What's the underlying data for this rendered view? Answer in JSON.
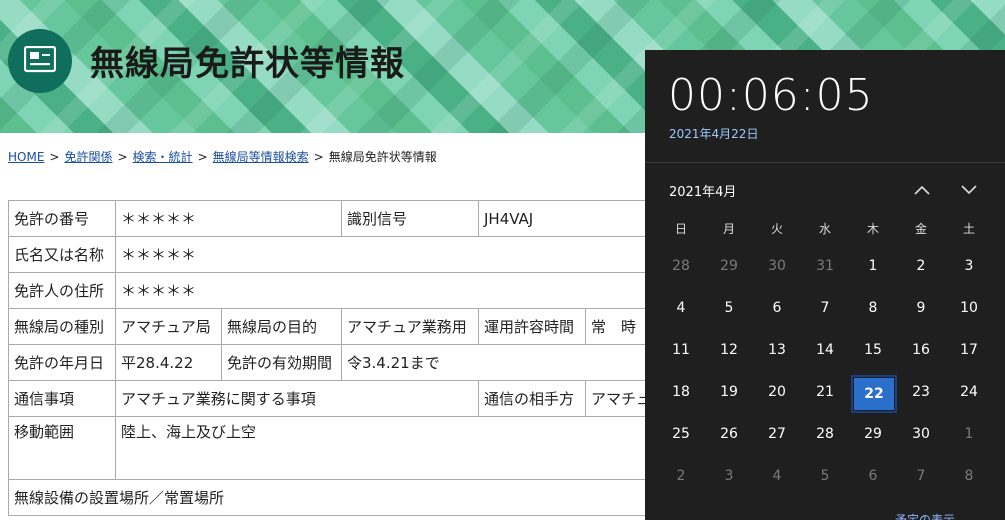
{
  "header": {
    "title": "無線局免許状等情報",
    "icon": "license-card-icon"
  },
  "breadcrumb": {
    "items": [
      "HOME",
      "免許関係",
      "検索・統計",
      "無線局等情報検索"
    ],
    "current": "無線局免許状等情報",
    "separator": ">"
  },
  "table": {
    "r1": {
      "c1": "免許の番号",
      "c2": "＊＊＊＊＊",
      "c3": "識別信号",
      "c4": "JH4VAJ"
    },
    "r2": {
      "c1": "氏名又は名称",
      "c2": "＊＊＊＊＊"
    },
    "r3": {
      "c1": "免許人の住所",
      "c2": "＊＊＊＊＊"
    },
    "r4": {
      "c1": "無線局の種別",
      "c2": "アマチュア局",
      "c3": "無線局の目的",
      "c4": "アマチュア業務用",
      "c5": "運用許容時間",
      "c6": "常　時"
    },
    "r5": {
      "c1": "免許の年月日",
      "c2": "平28.4.22",
      "c3": "免許の有効期間",
      "c4": "令3.4.21まで"
    },
    "r6": {
      "c1": "通信事項",
      "c2": "アマチュア業務に関する事項",
      "c3": "通信の相手方",
      "c4": "アマチュ"
    },
    "r7": {
      "c1": "移動範囲",
      "c2": "陸上、海上及び上空"
    },
    "r8": {
      "c1": "無線設備の設置場所／常置場所"
    }
  },
  "calendar": {
    "time": "00:06:05",
    "date": "2021年4月22日",
    "month_label": "2021年4月",
    "weekdays": [
      "日",
      "月",
      "火",
      "水",
      "木",
      "金",
      "土"
    ],
    "weeks": [
      [
        "28",
        "29",
        "30",
        "31",
        "1",
        "2",
        "3"
      ],
      [
        "4",
        "5",
        "6",
        "7",
        "8",
        "9",
        "10"
      ],
      [
        "11",
        "12",
        "13",
        "14",
        "15",
        "16",
        "17"
      ],
      [
        "18",
        "19",
        "20",
        "21",
        "22",
        "23",
        "24"
      ],
      [
        "25",
        "26",
        "27",
        "28",
        "29",
        "30",
        "1"
      ],
      [
        "2",
        "3",
        "4",
        "5",
        "6",
        "7",
        "8"
      ]
    ],
    "current_month_flags": [
      [
        false,
        false,
        false,
        false,
        true,
        true,
        true
      ],
      [
        true,
        true,
        true,
        true,
        true,
        true,
        true
      ],
      [
        true,
        true,
        true,
        true,
        true,
        true,
        true
      ],
      [
        true,
        true,
        true,
        true,
        true,
        true,
        true
      ],
      [
        true,
        true,
        true,
        true,
        true,
        true,
        false
      ],
      [
        false,
        false,
        false,
        false,
        false,
        false,
        false
      ]
    ],
    "today": "22",
    "more_label": "予定の表示",
    "colors": {
      "panel": "#1f1f1f",
      "today": "#2a6fc9",
      "accent_text": "#9ec8ff"
    }
  }
}
